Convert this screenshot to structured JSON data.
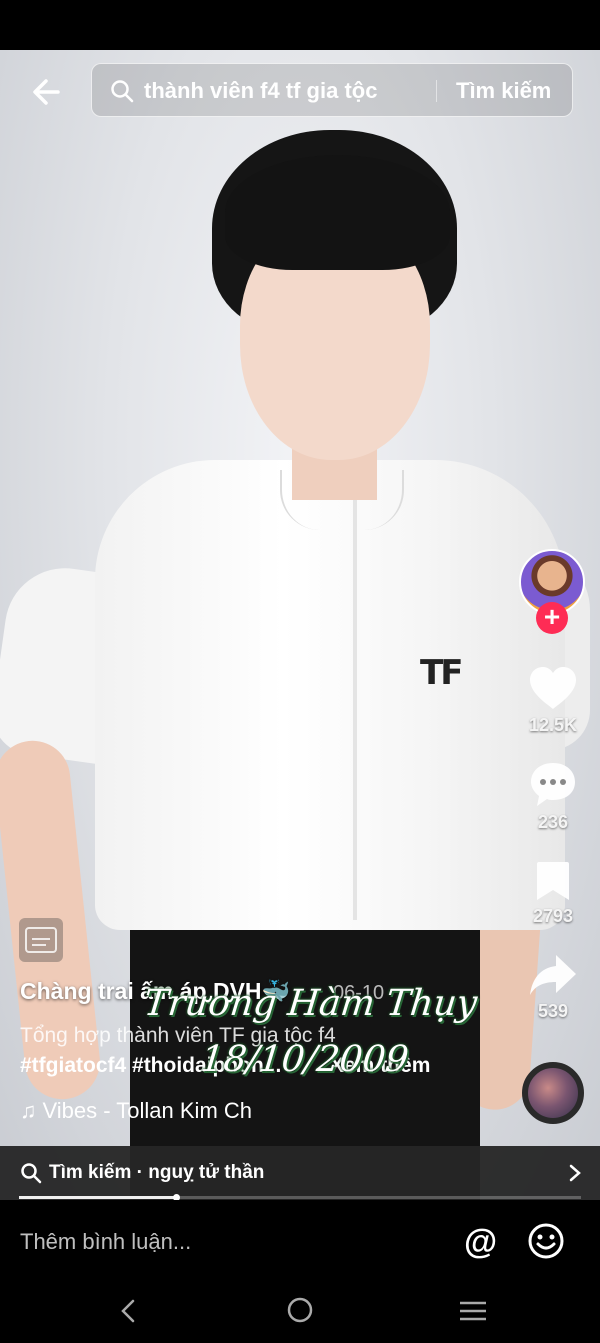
{
  "search": {
    "query": "thành viên f4 tf gia tộc",
    "button_label": "Tìm kiếm"
  },
  "actions": {
    "likes": "12.5K",
    "comments": "236",
    "saves": "2793",
    "shares": "539"
  },
  "video": {
    "author": "Chàng trai ấm áp DVH🐳",
    "date": "06-10",
    "description": "Tổng hợp thành viên TF gia tộc f4",
    "hashtags": "#tfgiatocf4 #thoidaiphon...",
    "see_more": "Xem thêm",
    "music": "Vibes - Tollan Kim    Ch",
    "overlay_line1": "Trương Hàm Thụy",
    "overlay_line2": "18/10/2009",
    "logo_text": "TF",
    "progress": 0.28
  },
  "related_search": {
    "text": "Tìm kiếm · nguỵ tử thần"
  },
  "comment": {
    "placeholder": "Thêm bình luận..."
  },
  "icons": {
    "back": "arrow-left-icon",
    "search": "search-icon",
    "like": "heart-icon",
    "comment": "comment-bubble-icon",
    "save": "bookmark-icon",
    "share": "share-arrow-icon",
    "mention": "at-icon",
    "emoji": "smiley-icon"
  },
  "colors": {
    "follow": "#fe2c55",
    "overlay_text_glow": "#1e5a2a"
  }
}
